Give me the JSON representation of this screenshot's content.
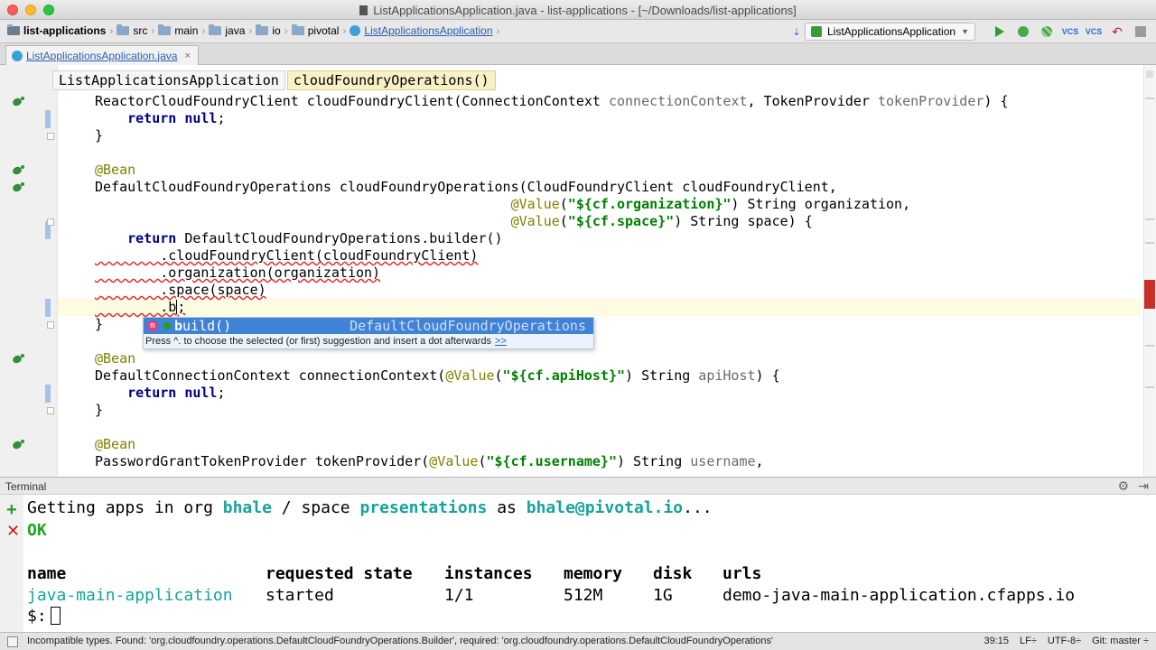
{
  "window": {
    "title": "ListApplicationsApplication.java - list-applications - [~/Downloads/list-applications]"
  },
  "nav": {
    "breadcrumbs": [
      "list-applications",
      "src",
      "main",
      "java",
      "io",
      "pivotal",
      "ListApplicationsApplication"
    ],
    "run_config": "ListApplicationsApplication"
  },
  "tabs": {
    "file_tab": "ListApplicationsApplication.java",
    "close": "×"
  },
  "editor": {
    "crumbs": [
      "ListApplicationsApplication",
      "cloudFoundryOperations()"
    ],
    "lines": [
      {
        "segments": [
          {
            "t": "ReactorCloudFoundryClient cloudFoundryClient(ConnectionContext ",
            "c": ""
          },
          {
            "t": "connectionContext",
            "c": "param"
          },
          {
            "t": ", TokenProvider ",
            "c": ""
          },
          {
            "t": "tokenProvider",
            "c": "param"
          },
          {
            "t": ") {",
            "c": ""
          }
        ]
      },
      {
        "segments": [
          {
            "t": "    ",
            "c": ""
          },
          {
            "t": "return null",
            "c": "kw"
          },
          {
            "t": ";",
            "c": ""
          }
        ]
      },
      {
        "segments": [
          {
            "t": "}",
            "c": ""
          }
        ]
      },
      {
        "segments": [
          {
            "t": "",
            "c": ""
          }
        ]
      },
      {
        "segments": [
          {
            "t": "@Bean",
            "c": "ann"
          }
        ]
      },
      {
        "segments": [
          {
            "t": "DefaultCloudFoundryOperations cloudFoundryOperations(CloudFoundryClient cloudFoundryClient,",
            "c": ""
          }
        ]
      },
      {
        "segments": [
          {
            "t": "                                                   ",
            "c": ""
          },
          {
            "t": "@Value",
            "c": "ann"
          },
          {
            "t": "(",
            "c": ""
          },
          {
            "t": "\"${cf.organization}\"",
            "c": "str"
          },
          {
            "t": ") String organization,",
            "c": ""
          }
        ]
      },
      {
        "segments": [
          {
            "t": "                                                   ",
            "c": ""
          },
          {
            "t": "@Value",
            "c": "ann"
          },
          {
            "t": "(",
            "c": ""
          },
          {
            "t": "\"${cf.space}\"",
            "c": "str"
          },
          {
            "t": ") String space) {",
            "c": ""
          }
        ]
      },
      {
        "segments": [
          {
            "t": "    ",
            "c": ""
          },
          {
            "t": "return",
            "c": "kw"
          },
          {
            "t": " DefaultCloudFoundryOperations.builder()",
            "c": ""
          }
        ]
      },
      {
        "segments": [
          {
            "t": "        .cloudFoundryClient(cloudFoundryClient)",
            "c": ""
          }
        ]
      },
      {
        "segments": [
          {
            "t": "        .organization(organization)",
            "c": ""
          }
        ]
      },
      {
        "segments": [
          {
            "t": "        .space(space)",
            "c": ""
          }
        ]
      },
      {
        "segments": [
          {
            "t": "        .b",
            "c": ""
          },
          {
            "t": "|",
            "c": "cursor"
          },
          {
            "t": ";",
            "c": ""
          }
        ]
      },
      {
        "segments": [
          {
            "t": "}",
            "c": ""
          }
        ]
      },
      {
        "segments": [
          {
            "t": "",
            "c": ""
          }
        ]
      },
      {
        "segments": [
          {
            "t": "@Bean",
            "c": "ann"
          }
        ]
      },
      {
        "segments": [
          {
            "t": "DefaultConnectionContext connectionContext(",
            "c": ""
          },
          {
            "t": "@Value",
            "c": "ann"
          },
          {
            "t": "(",
            "c": ""
          },
          {
            "t": "\"${cf.apiHost}\"",
            "c": "str"
          },
          {
            "t": ") String ",
            "c": ""
          },
          {
            "t": "apiHost",
            "c": "param"
          },
          {
            "t": ") {",
            "c": ""
          }
        ]
      },
      {
        "segments": [
          {
            "t": "    ",
            "c": ""
          },
          {
            "t": "return null",
            "c": "kw"
          },
          {
            "t": ";",
            "c": ""
          }
        ]
      },
      {
        "segments": [
          {
            "t": "}",
            "c": ""
          }
        ]
      },
      {
        "segments": [
          {
            "t": "",
            "c": ""
          }
        ]
      },
      {
        "segments": [
          {
            "t": "@Bean",
            "c": "ann"
          }
        ]
      },
      {
        "segments": [
          {
            "t": "PasswordGrantTokenProvider tokenProvider(",
            "c": ""
          },
          {
            "t": "@Value",
            "c": "ann"
          },
          {
            "t": "(",
            "c": ""
          },
          {
            "t": "\"${cf.username}\"",
            "c": "str"
          },
          {
            "t": ") String ",
            "c": ""
          },
          {
            "t": "username",
            "c": "param"
          },
          {
            "t": ",",
            "c": ""
          }
        ]
      }
    ],
    "completion": {
      "icon": "m",
      "match": "b",
      "rest": "uild()",
      "type": "DefaultCloudFoundryOperations",
      "hint": "Press ^. to choose the selected (or first) suggestion and insert a dot afterwards",
      "hint_link": ">>"
    }
  },
  "terminal": {
    "title": "Terminal",
    "line1": {
      "pre": "Getting apps in org ",
      "org": "bhale",
      "mid": " / space ",
      "space": "presentations",
      "as": " as ",
      "user": "bhale@pivotal.io",
      "post": "..."
    },
    "ok": "OK",
    "headers": [
      "name",
      "requested state",
      "instances",
      "memory",
      "disk",
      "urls"
    ],
    "rows": [
      [
        "java-main-application",
        "started",
        "1/1",
        "512M",
        "1G",
        "demo-java-main-application.cfapps.io"
      ]
    ],
    "prompt": "$:"
  },
  "status": {
    "message": "Incompatible types. Found: 'org.cloudfoundry.operations.DefaultCloudFoundryOperations.Builder', required: 'org.cloudfoundry.operations.DefaultCloudFoundryOperations'",
    "position": "39:15",
    "line_ending": "LF÷",
    "encoding": "UTF-8÷",
    "git": "Git: master ÷"
  }
}
